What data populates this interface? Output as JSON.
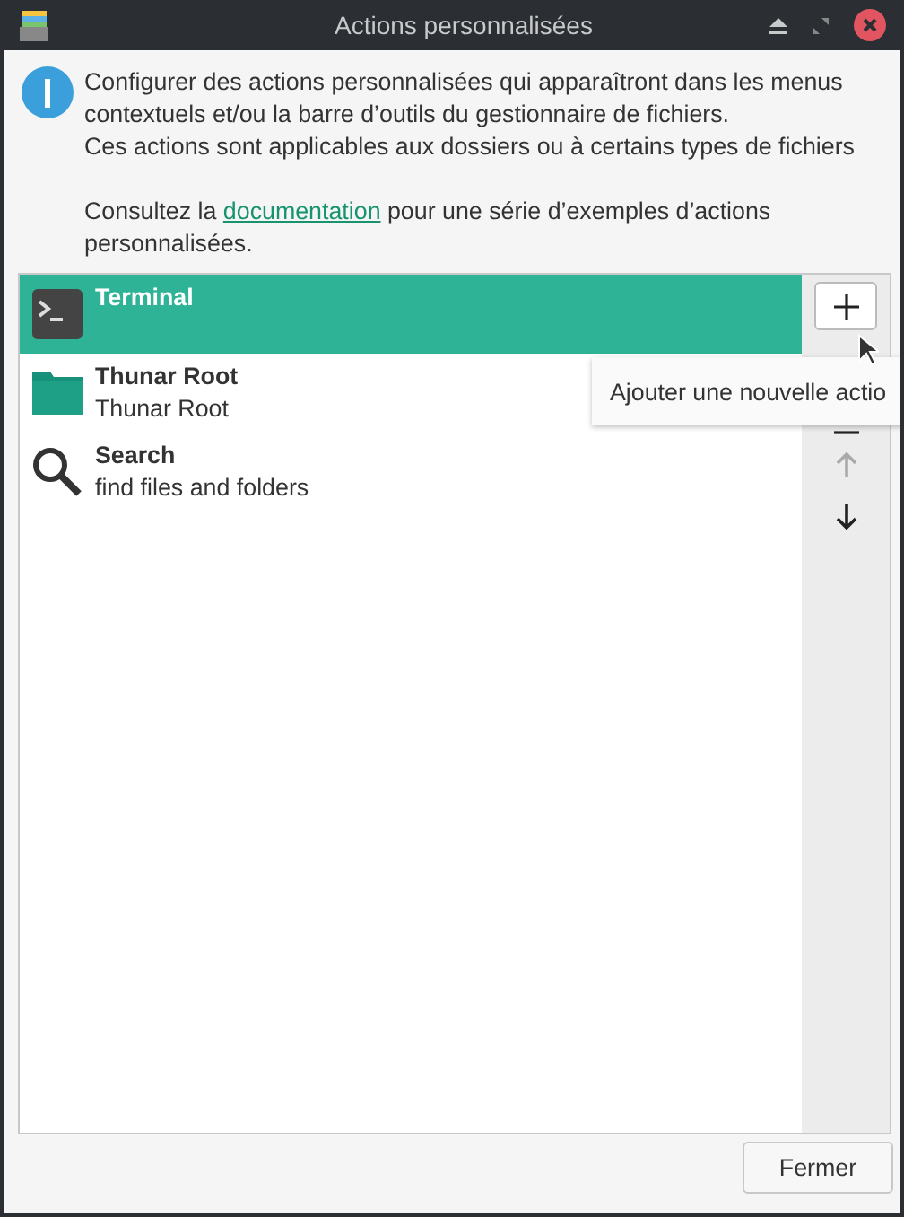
{
  "window": {
    "title": "Actions personnalisées"
  },
  "info": {
    "lines": [
      "Configurer des actions personnalisées qui apparaîtront dans les menus contextuels et/ou la barre d’outils du gestionnaire de fichiers.",
      "Ces actions sont applicables aux dossiers ou à certains types de fichiers"
    ],
    "doc_before": "Consultez la ",
    "doc_link": "documentation",
    "doc_after": " pour une série d’exemples d’actions personnalisées."
  },
  "actions": [
    {
      "kind": "terminal",
      "name": "Terminal",
      "selected": true
    },
    {
      "kind": "folder",
      "name": "Thunar Root",
      "description": "Thunar Root",
      "selected": false
    },
    {
      "kind": "search",
      "name": "Search",
      "description": "find files and folders",
      "selected": false
    }
  ],
  "side_buttons": [
    {
      "kind": "add",
      "disabled": false
    },
    {
      "kind": "remove",
      "disabled": false
    },
    {
      "kind": "up",
      "disabled": true
    },
    {
      "kind": "down",
      "disabled": false
    }
  ],
  "tooltip": "Ajouter une nouvelle actio",
  "close_button": "Fermer"
}
